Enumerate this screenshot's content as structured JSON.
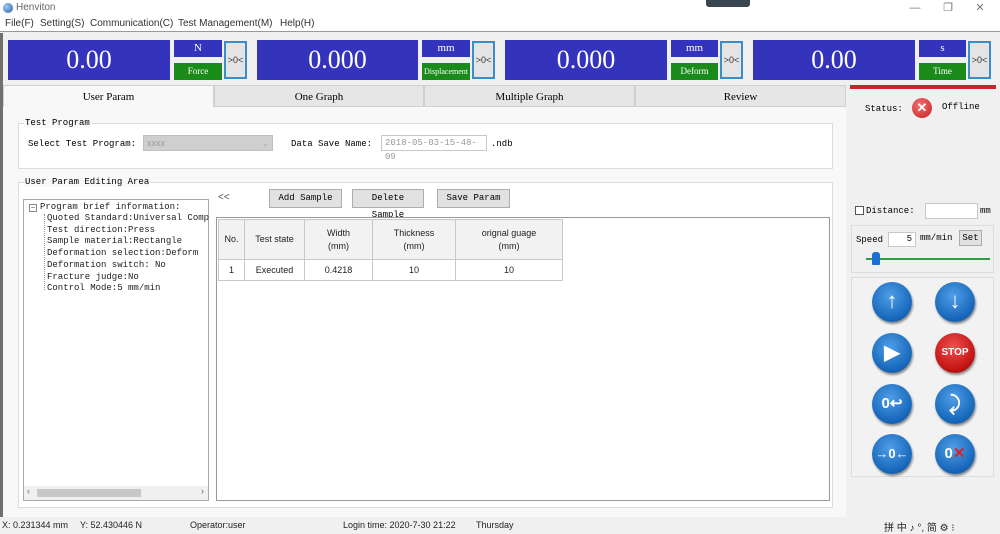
{
  "window": {
    "title": "Henviton",
    "minimize": "—",
    "restore": "❐",
    "close": "✕"
  },
  "menu": [
    "File(F)",
    "Setting(S)",
    "Communication(C)",
    "Test Management(M)",
    "Help(H)"
  ],
  "displays": [
    {
      "value": "0.00",
      "unit": "N",
      "label": "Force",
      "zero": ">0<"
    },
    {
      "value": "0.000",
      "unit": "mm",
      "label": "Displacement",
      "zero": ">0<"
    },
    {
      "value": "0.000",
      "unit": "mm",
      "label": "Deform",
      "zero": ">0<"
    },
    {
      "value": "0.00",
      "unit": "s",
      "label": "Time",
      "zero": ">0<"
    }
  ],
  "tabs": [
    "User Param",
    "One Graph",
    "Multiple Graph",
    "Review"
  ],
  "test_program": {
    "group_title": "Test Program",
    "select_label": "Select Test Program:",
    "select_value": "xxxx",
    "save_name_label": "Data Save Name:",
    "save_name_value": "2018-05-03-15-48-09",
    "save_ext": ".ndb"
  },
  "editing": {
    "group_title": "User Param Editing Area",
    "collapse": "<<",
    "tree_root": "Program brief information:",
    "tree_items": [
      "Quoted Standard:Universal Comp",
      "Test direction:Press",
      "Sample material:Rectangle",
      "Deformation selection:Deform",
      "Deformation switch: No",
      "Fracture judge:No",
      "Control Mode:5 mm/min"
    ],
    "buttons": {
      "add": "Add Sample",
      "delete": "Delete Sample",
      "save": "Save Param"
    },
    "table": {
      "headers": [
        [
          "No.",
          ""
        ],
        [
          "Test state",
          ""
        ],
        [
          "Width",
          "(mm)"
        ],
        [
          "Thickness",
          "(mm)"
        ],
        [
          "orignal guage",
          "(mm)"
        ]
      ],
      "rows": [
        [
          "1",
          "Executed",
          "0.4218",
          "10",
          "10"
        ]
      ]
    }
  },
  "right_panel": {
    "status_label": "Status:",
    "status_value": "Offline",
    "distance_label": "Distance:",
    "distance_value": "",
    "distance_unit": "mm",
    "speed_label": "Speed",
    "speed_value": "5",
    "speed_unit": "mm/min",
    "set_label": "Set",
    "slider_fraction": 0.05,
    "controls": [
      {
        "name": "up",
        "glyph": "🡅"
      },
      {
        "name": "down",
        "glyph": "🡇"
      },
      {
        "name": "start",
        "glyph": "▶"
      },
      {
        "name": "stop",
        "glyph": "STOP"
      },
      {
        "name": "return-zero",
        "glyph": "0↩"
      },
      {
        "name": "return",
        "glyph": "⟲"
      },
      {
        "name": "zero-all",
        "glyph": "→0←"
      },
      {
        "name": "clear-deform",
        "glyph": "0✕"
      }
    ]
  },
  "statusbar": {
    "x": "X: 0.231344 mm",
    "y": "Y: 52.430446 N",
    "operator": "Operator:user",
    "login": "Login time:  2020-7-30 21:22",
    "day": "Thursday",
    "ime": "拼 中 ♪ °, 简 ⚙ ⁝"
  }
}
